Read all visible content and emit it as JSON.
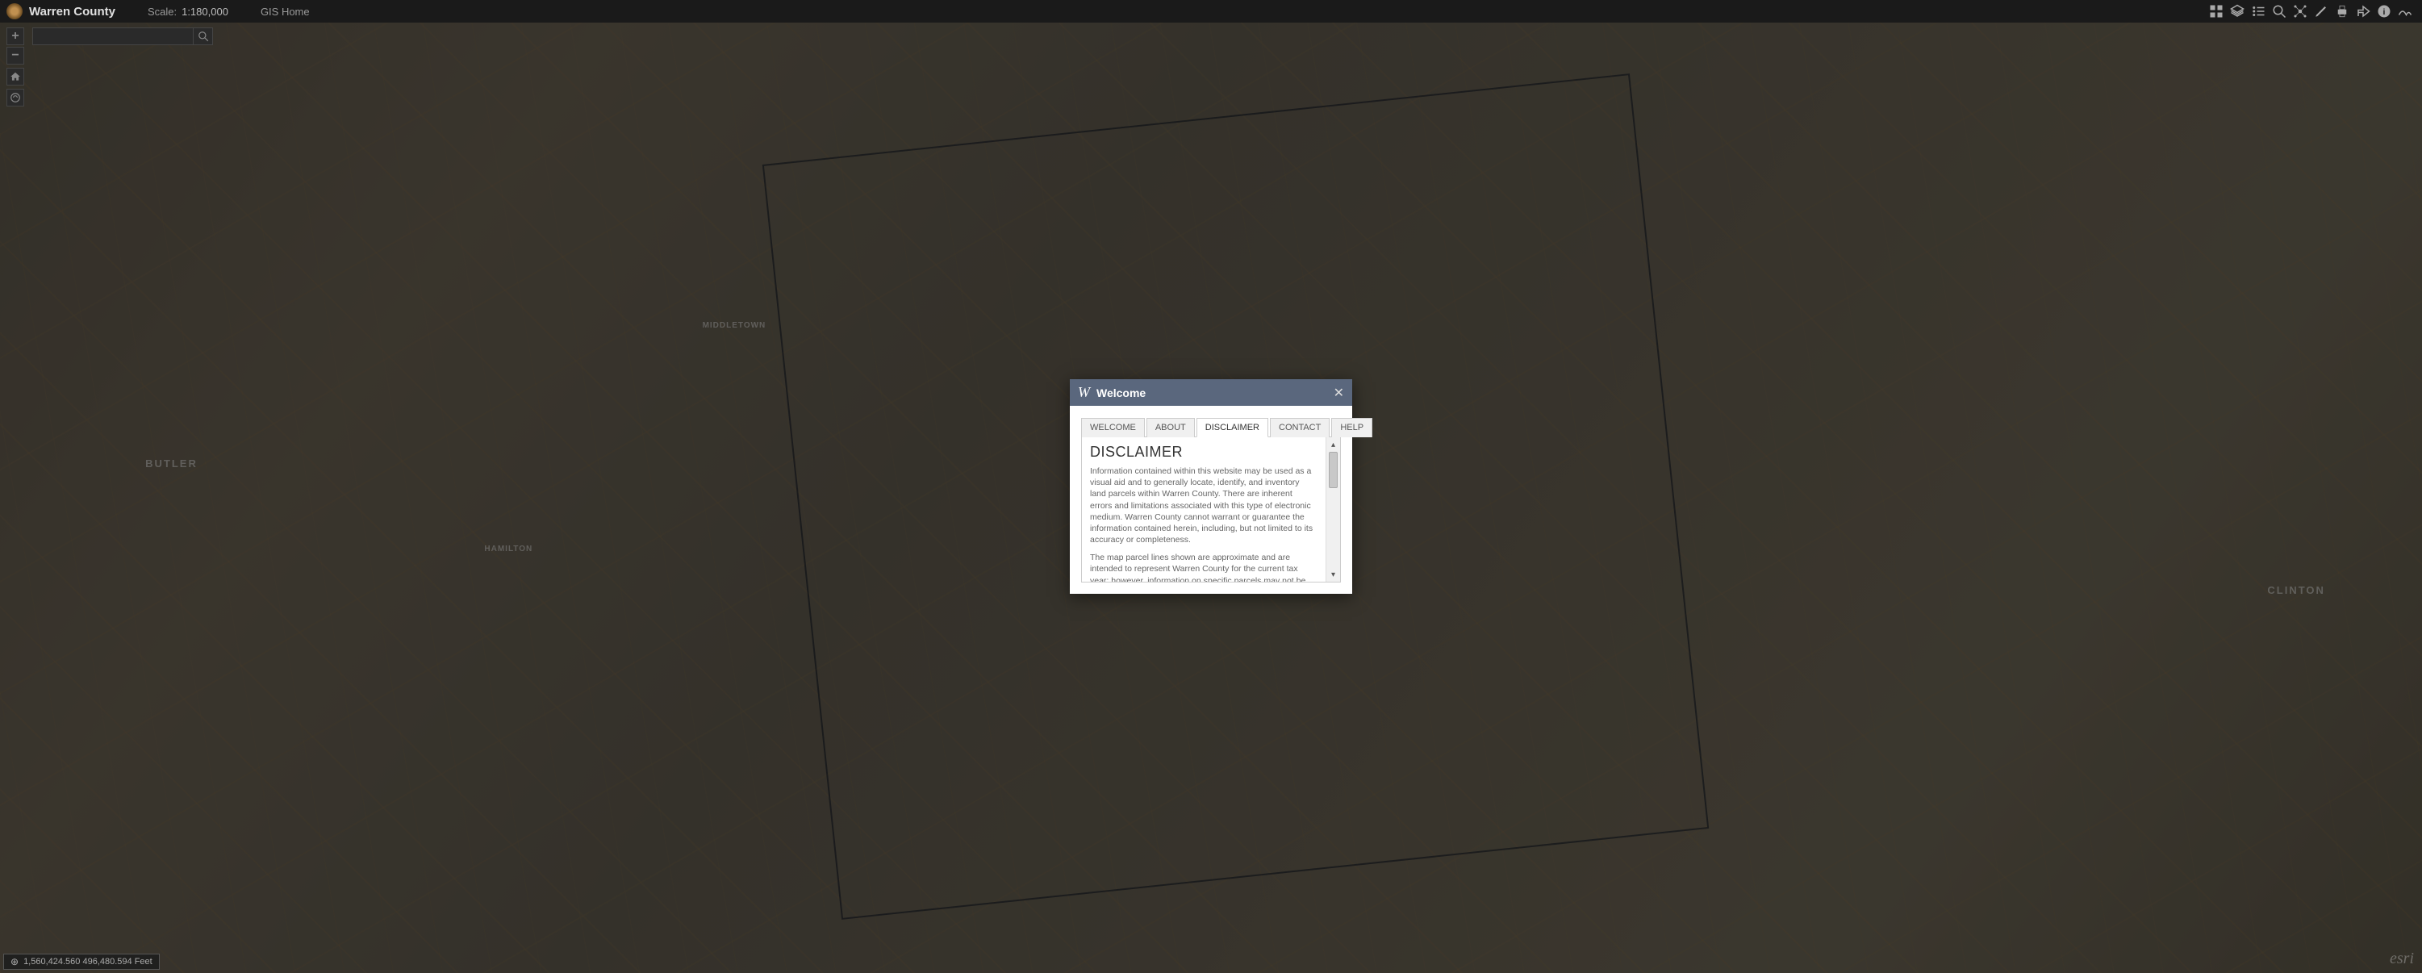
{
  "header": {
    "title": "Warren County",
    "scale_label": "Scale:",
    "scale_value": "1:180,000",
    "gis_home": "GIS Home"
  },
  "search": {
    "placeholder": ""
  },
  "modal": {
    "title": "Welcome",
    "tabs": [
      {
        "label": "WELCOME"
      },
      {
        "label": "ABOUT"
      },
      {
        "label": "DISCLAIMER"
      },
      {
        "label": "CONTACT"
      },
      {
        "label": "HELP"
      }
    ],
    "active_tab": 2,
    "disclaimer": {
      "heading": "DISCLAIMER",
      "p1": "Information contained within this website may be used as a visual aid and to generally locate, identify, and inventory land parcels within Warren County. There are inherent errors and limitations associated with this type of electronic medium. Warren County cannot warrant or guarantee the information contained herein, including, but not limited to its accuracy or completeness.",
      "p2": "The map parcel lines shown are approximate and are intended to represent Warren County for the current tax year; however, information on specific parcels may not be current. This"
    }
  },
  "status": {
    "coords": "1,560,424.560 496,480.594 Feet"
  },
  "attribution": "esri",
  "map_labels": {
    "butler": "BUTLER",
    "clinton": "CLINTON",
    "middletown": "MIDDLETOWN",
    "hamilton": "HAMILTON"
  },
  "tools": {
    "basemap": "basemap-icon",
    "layers": "layers-icon",
    "legend": "legend-icon",
    "search": "search-icon",
    "network": "network-icon",
    "edit": "edit-icon",
    "print": "print-icon",
    "share": "share-icon",
    "info": "info-icon",
    "wave": "wave-icon"
  }
}
